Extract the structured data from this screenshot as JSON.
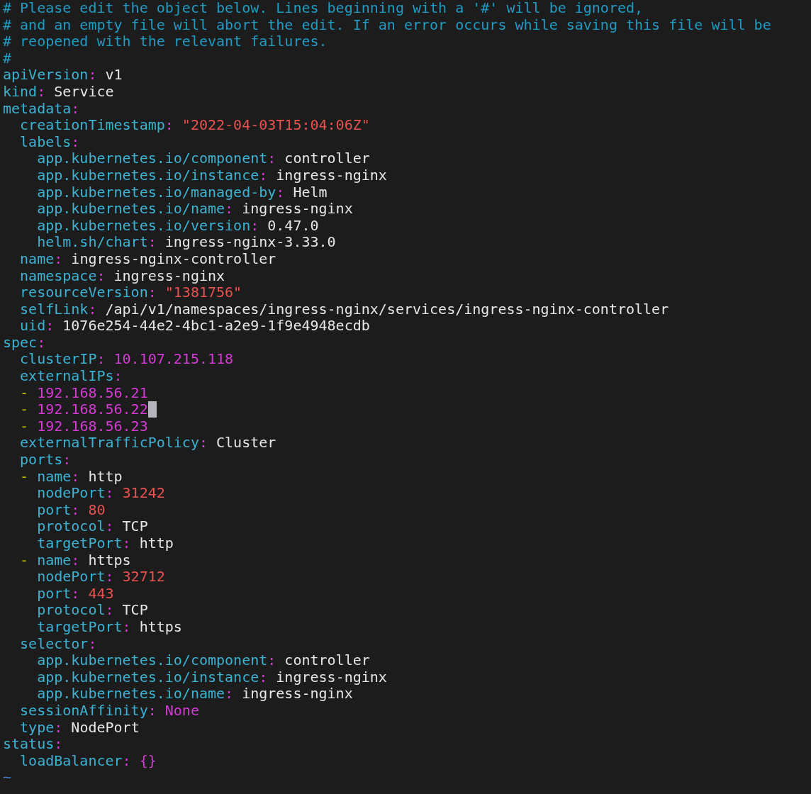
{
  "comments": [
    "# Please edit the object below. Lines beginning with a '#' will be ignored,",
    "# and an empty file will abort the edit. If an error occurs while saving this file will be",
    "# reopened with the relevant failures.",
    "#"
  ],
  "document": [
    {
      "key": "apiVersion:",
      "value": "v1",
      "kind": "plain"
    },
    {
      "key": "kind:",
      "value": "Service",
      "kind": "plain"
    },
    {
      "key": "metadata:",
      "children": [
        {
          "key": "creationTimestamp:",
          "value": "\"2022-04-03T15:04:06Z\"",
          "kind": "string"
        },
        {
          "key": "labels:",
          "children": [
            {
              "key": "app.kubernetes.io/component:",
              "value": "controller",
              "kind": "plain"
            },
            {
              "key": "app.kubernetes.io/instance:",
              "value": "ingress-nginx",
              "kind": "plain"
            },
            {
              "key": "app.kubernetes.io/managed-by:",
              "value": "Helm",
              "kind": "plain"
            },
            {
              "key": "app.kubernetes.io/name:",
              "value": "ingress-nginx",
              "kind": "plain"
            },
            {
              "key": "app.kubernetes.io/version:",
              "value": "0.47.0",
              "kind": "plain"
            },
            {
              "key": "helm.sh/chart:",
              "value": "ingress-nginx-3.33.0",
              "kind": "plain"
            }
          ]
        },
        {
          "key": "name:",
          "value": "ingress-nginx-controller",
          "kind": "plain"
        },
        {
          "key": "namespace:",
          "value": "ingress-nginx",
          "kind": "plain"
        },
        {
          "key": "resourceVersion:",
          "value": "\"1381756\"",
          "kind": "string"
        },
        {
          "key": "selfLink:",
          "value": "/api/v1/namespaces/ingress-nginx/services/ingress-nginx-controller",
          "kind": "plain"
        },
        {
          "key": "uid:",
          "value": "1076e254-44e2-4bc1-a2e9-1f9e4948ecdb",
          "kind": "plain"
        }
      ]
    },
    {
      "key": "spec:",
      "children": [
        {
          "key": "clusterIP:",
          "value": "10.107.215.118",
          "kind": "constant"
        },
        {
          "key": "externalIPs:",
          "items": [
            {
              "marker": "-",
              "value": "192.168.56.21",
              "kind": "constant",
              "cursor": false
            },
            {
              "marker": "-",
              "value": "192.168.56.22",
              "kind": "constant",
              "cursor": true
            },
            {
              "marker": "-",
              "value": "192.168.56.23",
              "kind": "constant",
              "cursor": false
            }
          ]
        },
        {
          "key": "externalTrafficPolicy:",
          "value": "Cluster",
          "kind": "plain"
        },
        {
          "key": "ports:",
          "items": [
            {
              "marker": "-",
              "fields": [
                {
                  "key": "name:",
                  "value": "http",
                  "kind": "plain"
                },
                {
                  "key": "nodePort:",
                  "value": "31242",
                  "kind": "number"
                },
                {
                  "key": "port:",
                  "value": "80",
                  "kind": "number"
                },
                {
                  "key": "protocol:",
                  "value": "TCP",
                  "kind": "plain"
                },
                {
                  "key": "targetPort:",
                  "value": "http",
                  "kind": "plain"
                }
              ]
            },
            {
              "marker": "-",
              "fields": [
                {
                  "key": "name:",
                  "value": "https",
                  "kind": "plain"
                },
                {
                  "key": "nodePort:",
                  "value": "32712",
                  "kind": "number"
                },
                {
                  "key": "port:",
                  "value": "443",
                  "kind": "number"
                },
                {
                  "key": "protocol:",
                  "value": "TCP",
                  "kind": "plain"
                },
                {
                  "key": "targetPort:",
                  "value": "https",
                  "kind": "plain"
                }
              ]
            }
          ]
        },
        {
          "key": "selector:",
          "children": [
            {
              "key": "app.kubernetes.io/component:",
              "value": "controller",
              "kind": "plain"
            },
            {
              "key": "app.kubernetes.io/instance:",
              "value": "ingress-nginx",
              "kind": "plain"
            },
            {
              "key": "app.kubernetes.io/name:",
              "value": "ingress-nginx",
              "kind": "plain"
            }
          ]
        },
        {
          "key": "sessionAffinity:",
          "value": "None",
          "kind": "constant"
        },
        {
          "key": "type:",
          "value": "NodePort",
          "kind": "plain"
        }
      ]
    },
    {
      "key": "status:",
      "children": [
        {
          "key": "loadBalancer:",
          "value": "{}",
          "kind": "constant"
        }
      ]
    }
  ],
  "empty_line_marker": "~"
}
